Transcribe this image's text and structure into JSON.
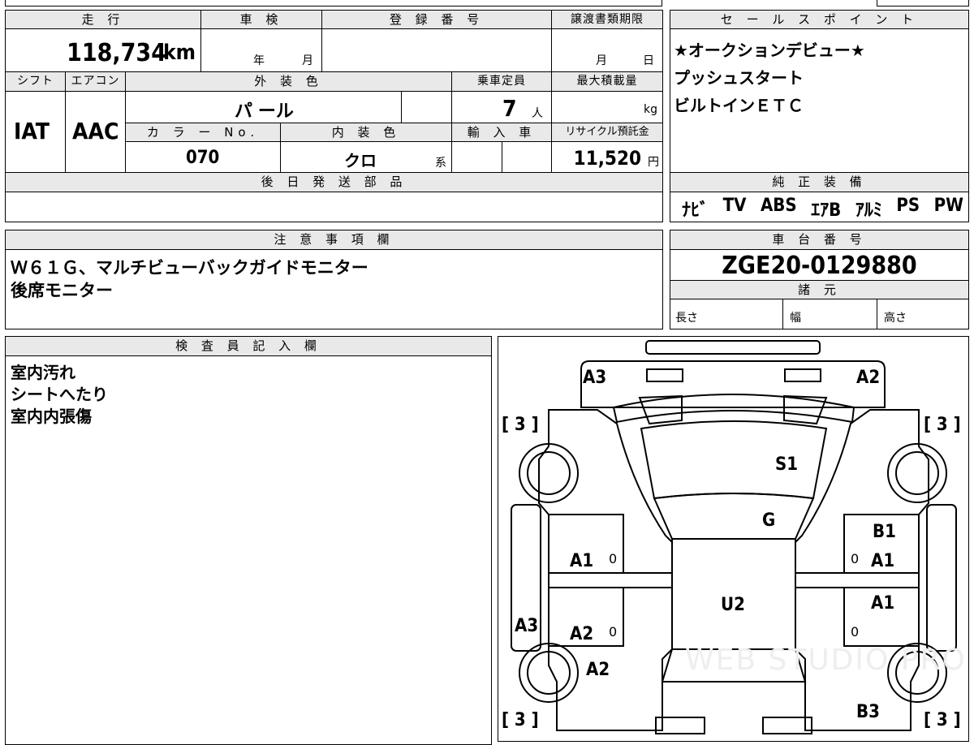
{
  "top": {
    "odometer_header": "走 行",
    "odometer_value": "118,734",
    "odometer_unit": "km",
    "inspection_header": "車 検",
    "inspection_year_unit": "年",
    "inspection_month_unit": "月",
    "registration_header": "登 録 番 号",
    "transfer_header": "譲渡書類期限",
    "transfer_month_unit": "月",
    "transfer_day_unit": "日",
    "shift_header": "シフト",
    "shift_value": "IAT",
    "ac_header": "エアコン",
    "ac_value": "AAC",
    "exterior_header": "外 装 色",
    "exterior_value": "パ ール",
    "capacity_header": "乗車定員",
    "capacity_value": "7",
    "capacity_unit": "人",
    "maxload_header": "最大積載量",
    "maxload_unit": "kg",
    "colorno_header": "カ ラ ー No.",
    "colorno_value": "070",
    "interior_header": "内 装 色",
    "interior_value": "クロ",
    "interior_suffix": "系",
    "import_header": "輸 入 車",
    "recycle_header": "リサイクル預託金",
    "recycle_value": "11,520",
    "recycle_unit": "円",
    "later_parts_header": "後 日 発 送 部 品"
  },
  "sales": {
    "header": "セ ー ル ス ポ イ ン ト",
    "lines": [
      "★オークションデビュー★",
      "プッシュスタート",
      "ビルトインＥＴＣ"
    ]
  },
  "equipment": {
    "header": "純 正 装 備",
    "items": [
      "ﾅﾋﾞ",
      "TV",
      "ABS",
      "ｴｱB",
      "ｱﾙﾐ",
      "PS",
      "PW"
    ]
  },
  "notes": {
    "header": "注 意 事 項 欄",
    "lines": [
      "Ｗ６１Ｇ、マルチビューバックガイドモニター",
      "後席モニター"
    ]
  },
  "chassis": {
    "header": "車 台 番 号",
    "value": "ZGE20-0129880",
    "specs_header": "諸 元",
    "length_label": "長さ",
    "width_label": "幅",
    "height_label": "高さ"
  },
  "inspector": {
    "header": "検 査 員 記 入 欄",
    "lines": [
      "室内汚れ",
      "シートへたり",
      "室内内張傷"
    ]
  },
  "diagram": {
    "labels": {
      "a3_top_left": "A3",
      "a2_top_right": "A2",
      "tire_fl": "[ 3 ]",
      "tire_fr": "[ 3 ]",
      "tire_rl": "[ 3 ]",
      "tire_rr": "[ 3 ]",
      "s1": "S1",
      "g": "G",
      "b1": "B1",
      "a1_left": "A1",
      "a1_right": "A1",
      "a1_right_rear": "A1",
      "u2": "U2",
      "a3_left": "A3",
      "a2_left": "A2",
      "a2_left_lower": "A2",
      "b3": "B3",
      "zero1": "0",
      "zero2": "0",
      "zero3": "0",
      "zero4": "0"
    },
    "watermark": "WEB STUDIO PRO"
  }
}
